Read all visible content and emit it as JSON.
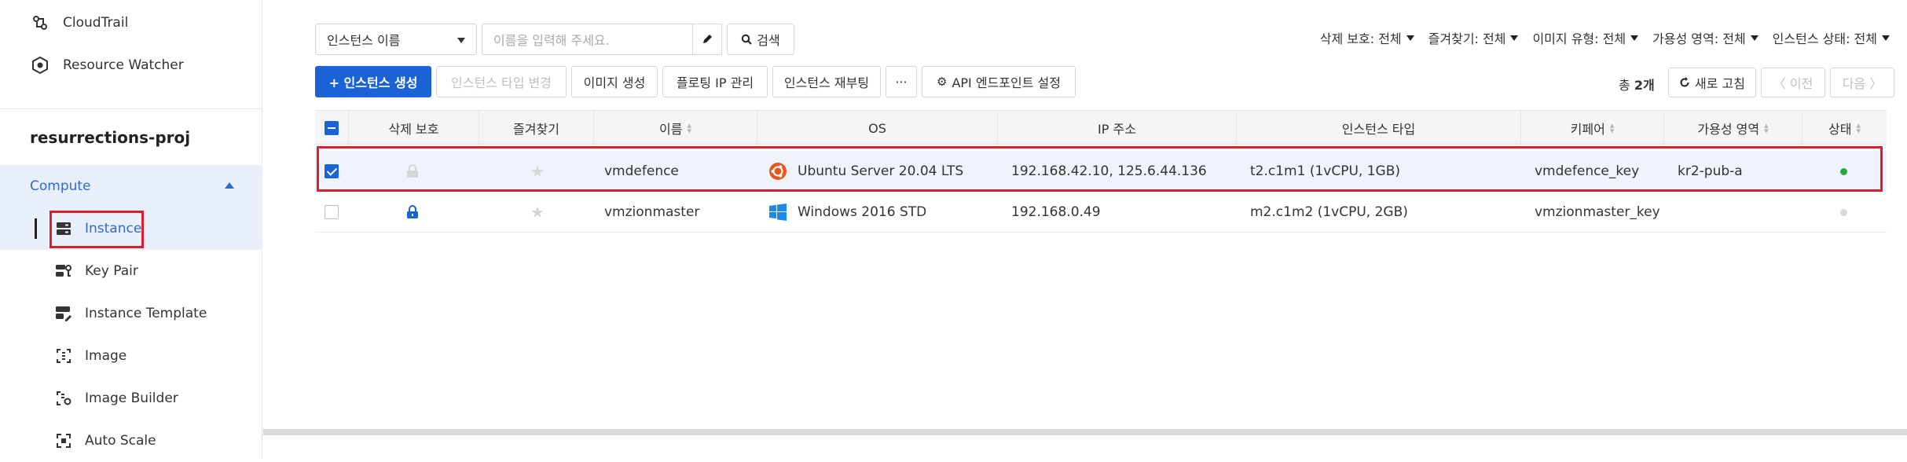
{
  "sidebar": {
    "top_items": [
      {
        "label": "CloudTrail",
        "icon": "cloudtrail-icon"
      },
      {
        "label": "Resource Watcher",
        "icon": "resource-watcher-icon"
      }
    ],
    "project_name": "resurrections-proj",
    "section": {
      "label": "Compute",
      "expanded": true
    },
    "items": [
      {
        "label": "Instance",
        "icon": "instance-icon",
        "active": true
      },
      {
        "label": "Key Pair",
        "icon": "key-pair-icon"
      },
      {
        "label": "Instance Template",
        "icon": "instance-template-icon"
      },
      {
        "label": "Image",
        "icon": "image-icon"
      },
      {
        "label": "Image Builder",
        "icon": "image-builder-icon"
      },
      {
        "label": "Auto Scale",
        "icon": "auto-scale-icon"
      }
    ]
  },
  "search": {
    "field_select": "인스턴스 이름",
    "placeholder": "이름을 입력해 주세요.",
    "search_label": "검색"
  },
  "filters": [
    {
      "label": "삭제 보호: 전체"
    },
    {
      "label": "즐겨찾기: 전체"
    },
    {
      "label": "이미지 유형: 전체"
    },
    {
      "label": "가용성 영역: 전체"
    },
    {
      "label": "인스턴스 상태: 전체"
    }
  ],
  "toolbar": {
    "create": "+ 인스턴스 생성",
    "change_type": "인스턴스 타입 변경",
    "create_image": "이미지 생성",
    "floating_ip": "플로팅 IP 관리",
    "reboot": "인스턴스 재부팅",
    "more": "···",
    "api_endpoint": "API 엔드포인트 설정"
  },
  "pagination": {
    "total_prefix": "총",
    "total_count": "2개",
    "refresh": "새로 고침",
    "prev": "〈 이전",
    "next": "다음 〉"
  },
  "table": {
    "headers": {
      "delete_protect": "삭제 보호",
      "favorite": "즐겨찾기",
      "name": "이름",
      "os": "OS",
      "ip": "IP 주소",
      "type": "인스턴스 타입",
      "keypair": "키페어",
      "zone": "가용성 영역",
      "status": "상태"
    },
    "rows": [
      {
        "selected": true,
        "locked": false,
        "name": "vmdefence",
        "os": "Ubuntu Server 20.04 LTS",
        "os_icon": "ubuntu-icon",
        "ip": "192.168.42.10, 125.6.44.136",
        "type": "t2.c1m1 (1vCPU, 1GB)",
        "keypair": "vmdefence_key",
        "zone": "kr2-pub-a",
        "status_color": "#2aa845"
      },
      {
        "selected": false,
        "locked": true,
        "name": "vmzionmaster",
        "os": "Windows 2016 STD",
        "os_icon": "windows-icon",
        "ip": "192.168.0.49",
        "type": "m2.c1m2 (1vCPU, 2GB)",
        "keypair": "vmzionmaster_key",
        "zone": "",
        "status_color": "#d9d9d9"
      }
    ]
  },
  "colors": {
    "accent": "#1a63d6",
    "highlight": "#d9212e",
    "running": "#2aa845"
  }
}
